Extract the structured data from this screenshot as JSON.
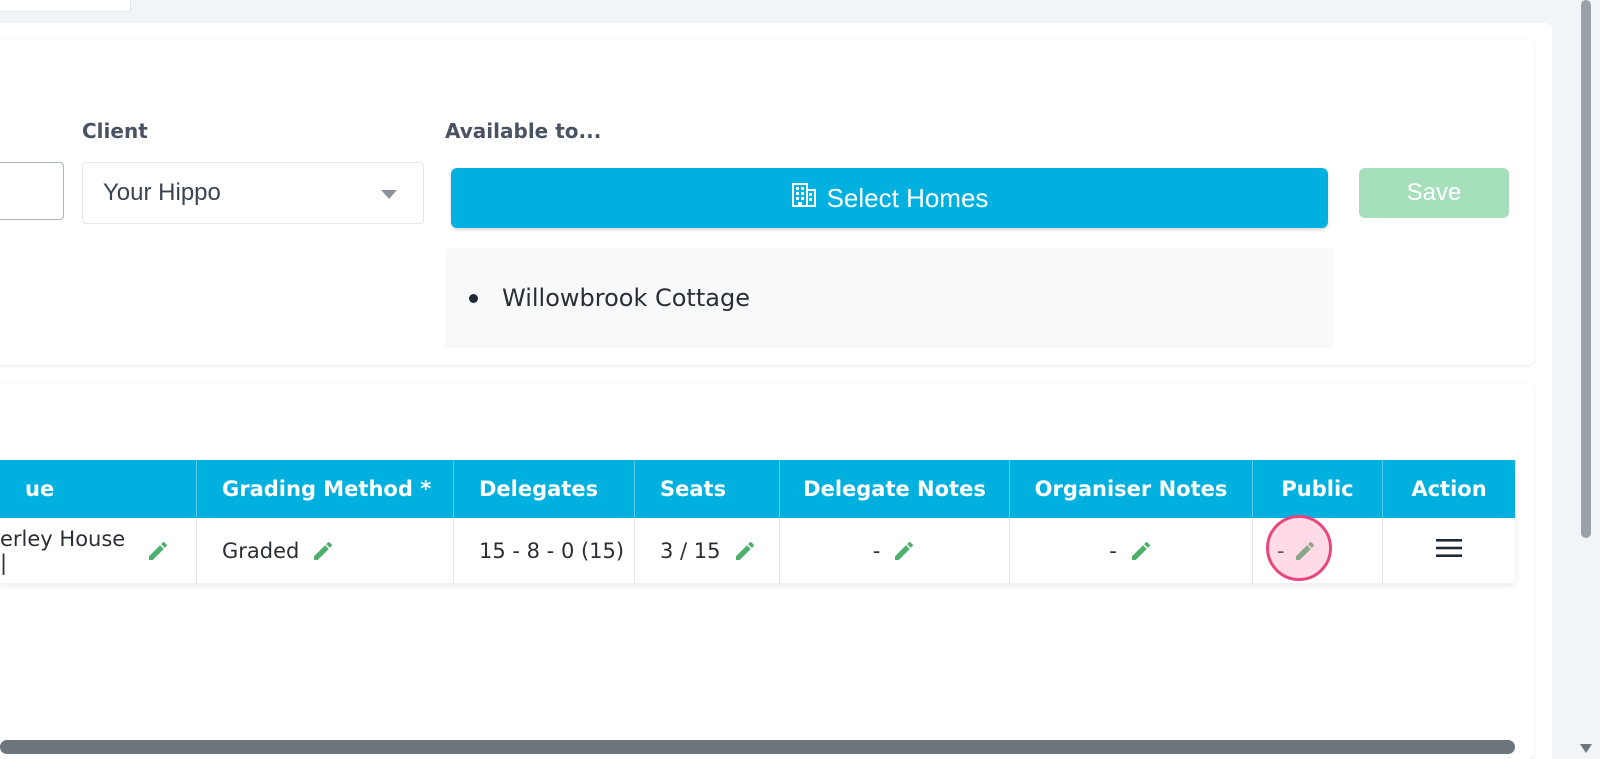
{
  "form": {
    "client_label": "Client",
    "client_value": "Your Hippo",
    "available_label": "Available to...",
    "select_homes_label": "Select Homes",
    "save_label": "Save",
    "homes": [
      "Willowbrook Cottage"
    ]
  },
  "table": {
    "headers": [
      "ue",
      "Grading Method *",
      "Delegates",
      "Seats",
      "Delegate Notes",
      "Organiser Notes",
      "Public",
      "Action"
    ],
    "row": {
      "venue": "erley House |",
      "grading": "Graded",
      "delegates": "15 - 8 - 0 (15)",
      "seats": "3 / 15",
      "delegate_notes": "-",
      "organiser_notes": "-",
      "public": "-"
    }
  },
  "colors": {
    "primary": "#00b0df",
    "save_disabled": "#a6dfbb",
    "pencil": "#4fb06d",
    "highlight": "#e8467f"
  },
  "icons": {
    "select_homes": "building-icon",
    "edit": "pencil-icon",
    "action": "hamburger-menu-icon",
    "dropdown": "caret-down-icon"
  }
}
